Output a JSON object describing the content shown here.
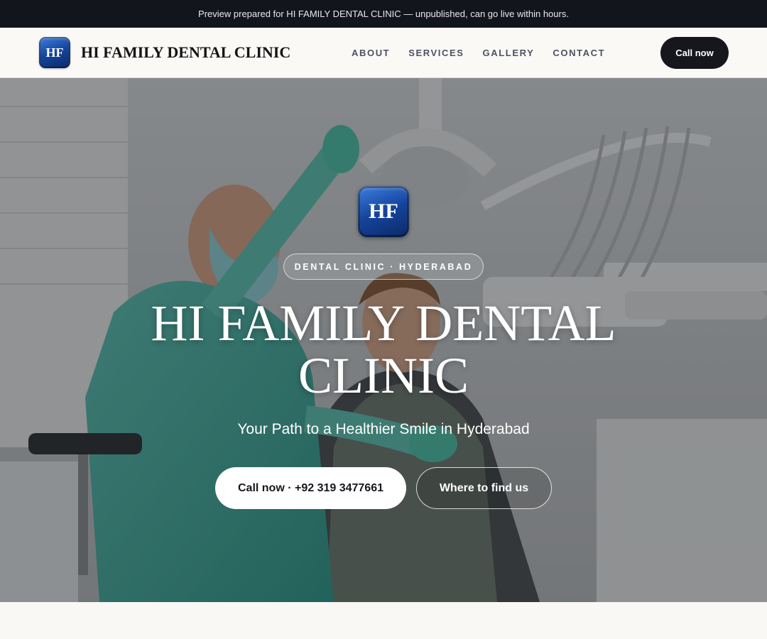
{
  "announcement": "Preview prepared for HI FAMILY DENTAL CLINIC — unpublished, can go live within hours.",
  "brand": {
    "logo_text": "HF",
    "name": "HI FAMILY DENTAL CLINIC",
    "colors": {
      "logo_top": "#3d7fe0",
      "logo_bottom": "#0b2a66"
    }
  },
  "nav": {
    "items": [
      {
        "label": "ABOUT"
      },
      {
        "label": "SERVICES"
      },
      {
        "label": "GALLERY"
      },
      {
        "label": "CONTACT"
      }
    ],
    "call_label": "Call now"
  },
  "hero": {
    "logo_text": "HF",
    "eyebrow": "DENTAL CLINIC · HYDERABAD",
    "title": "HI FAMILY DENTAL CLINIC",
    "subtitle": "Your Path to a Healthier Smile in Hyderabad",
    "primary_cta": "Call now · +92 319 3477661",
    "secondary_cta": "Where to find us",
    "background_image": "dentist in teal scrubs treating a smiling patient in dental chair"
  },
  "colors": {
    "announcement_bg": "#12151b",
    "header_bg": "#faf9f6",
    "button_dark": "#15171c",
    "page_bg": "#f9f8f5"
  }
}
